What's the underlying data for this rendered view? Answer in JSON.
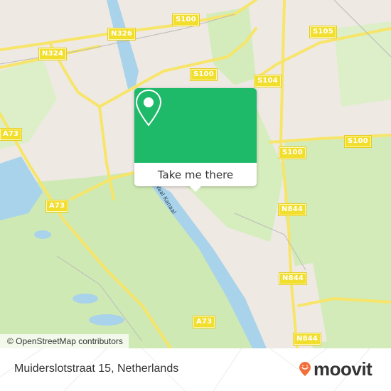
{
  "map": {
    "attribution": "© OpenStreetMap contributors",
    "road_labels": [
      {
        "text": "N326"
      },
      {
        "text": "S100"
      },
      {
        "text": "N324"
      },
      {
        "text": "S105"
      },
      {
        "text": "S100"
      },
      {
        "text": "S104"
      },
      {
        "text": "A73"
      },
      {
        "text": "S100"
      },
      {
        "text": "S100"
      },
      {
        "text": "A73"
      },
      {
        "text": "N844"
      },
      {
        "text": "N844"
      },
      {
        "text": "A73"
      },
      {
        "text": "N844"
      }
    ],
    "canal_label": "-Waal Kanaal",
    "colors": {
      "land": "#efe9e4",
      "park": "#cfe9b4",
      "water": "#a9d3ea",
      "road": "#f7e56a"
    }
  },
  "popup": {
    "button_label": "Take me there",
    "accent_color": "#1fb96a"
  },
  "footer": {
    "address": "Muiderslotstraat 15, Netherlands",
    "brand": "moovit",
    "brand_color": "#f26f3b"
  }
}
